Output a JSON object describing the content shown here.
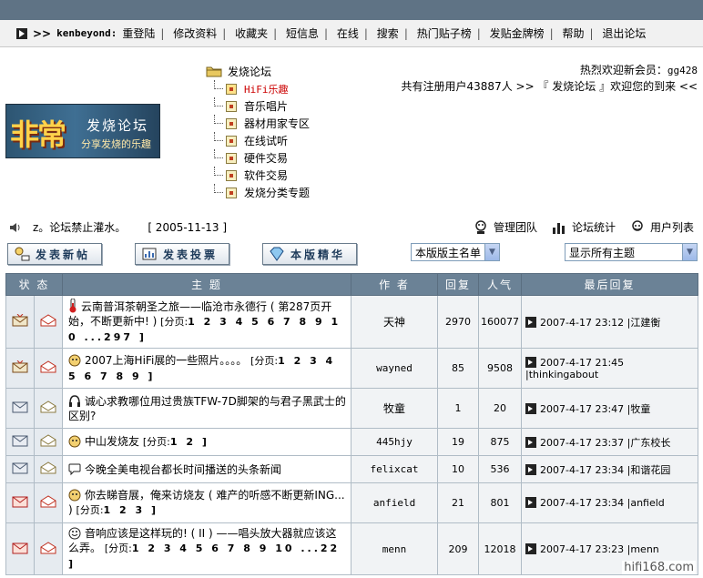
{
  "nav": {
    "chevron": ">>",
    "username": "kenbeyond:",
    "links": [
      "重登陆",
      "修改资料",
      "收藏夹",
      "短信息",
      "在线",
      "搜索",
      "热门贴子榜",
      "发贴金牌榜",
      "帮助",
      "退出论坛"
    ]
  },
  "logo": {
    "big": "非常",
    "line1": "发烧论坛",
    "line2": "分享发烧的乐趣"
  },
  "tree": {
    "root": "发烧论坛",
    "items": [
      "HiFi乐趣",
      "音乐唱片",
      "器材用家专区",
      "在线试听",
      "硬件交易",
      "软件交易",
      "发烧分类专题"
    ]
  },
  "welcome": {
    "text": "热烈欢迎新会员：",
    "user": "gg428"
  },
  "members": {
    "text": "共有注册用户43887人 >> 『 发烧论坛 』欢迎您的到来 <<"
  },
  "announce": {
    "text": "z。论坛禁止灌水。",
    "date": "[ 2005-11-13 ]"
  },
  "tools": [
    "管理团队",
    "论坛统计",
    "用户列表"
  ],
  "buttons": {
    "new_post": "发表新帖",
    "new_poll": "发表投票",
    "essence": "本版精华"
  },
  "selects": {
    "moderators": "本版版主名单",
    "filter": "显示所有主题"
  },
  "table": {
    "headers": {
      "status": "状 态",
      "topic": "主 题",
      "author": "作 者",
      "replies": "回复",
      "views": "人气",
      "last": "最后回复"
    },
    "rows": [
      {
        "title": "云南普洱茶朝圣之旅——临沧市永德行 ( 第287页开始，不断更新中! )",
        "pages_label": "[分页:",
        "pages": "1 2 3 4 5 6 7 8 9 1 0 ...297 ]",
        "author": "天神",
        "replies": "2970",
        "views": "160077",
        "last": "2007-4-17 23:12 |江建衡"
      },
      {
        "title": "2007上海HiFi展的一些照片。。。。",
        "pages_label": "[分页:",
        "pages": "1 2 3 4 5 6 7 8 9 ]",
        "author": "wayned",
        "replies": "85",
        "views": "9508",
        "last": "2007-4-17 21:45 |thinkingabout"
      },
      {
        "title": "诚心求教哪位用过贵族TFW-7D脚架的与君子黑武士的区别?",
        "pages_label": "",
        "pages": "",
        "author": "牧童",
        "replies": "1",
        "views": "20",
        "last": "2007-4-17 23:47 |牧童"
      },
      {
        "title": "中山发烧友",
        "pages_label": "[分页:",
        "pages": "1 2 ]",
        "author": "445hjy",
        "replies": "19",
        "views": "875",
        "last": "2007-4-17 23:37 |广东校长"
      },
      {
        "title": "今晚全美电视台都长时间播送的头条新闻",
        "pages_label": "",
        "pages": "",
        "author": "felixcat",
        "replies": "10",
        "views": "536",
        "last": "2007-4-17 23:34 |和谐花园"
      },
      {
        "title": "你去睇音展，俺来访烧友 ( 难产的听感不断更新ING... )",
        "pages_label": "[分页:",
        "pages": "1 2 3 ]",
        "author": "anfield",
        "replies": "21",
        "views": "801",
        "last": "2007-4-17 23:34 |anfield"
      },
      {
        "title": "音响应该是这样玩的! ( II ) ——唱头放大器就应该这么弄。",
        "pages_label": "[分页:",
        "pages": "1 2 3 4 5 6 7 8 9 10 ...22 ]",
        "author": "menn",
        "replies": "209",
        "views": "12018",
        "last": "2007-4-17 23:23 |menn"
      }
    ]
  },
  "watermark": "hifi168.com"
}
